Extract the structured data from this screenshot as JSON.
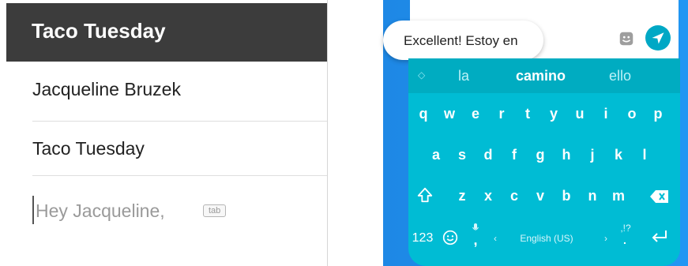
{
  "compose": {
    "header_title": "Taco Tuesday",
    "to": "Jacqueline Bruzek",
    "subject": "Taco Tuesday",
    "body_text": "Hey Jacqueline,",
    "tab_hint": "tab"
  },
  "chat": {
    "suggestion_text": "Excellent! Estoy en"
  },
  "keyboard": {
    "suggestions": [
      "la",
      "camino",
      "ello"
    ],
    "row1": [
      "q",
      "w",
      "e",
      "r",
      "t",
      "y",
      "u",
      "i",
      "o",
      "p"
    ],
    "row2": [
      "a",
      "s",
      "d",
      "f",
      "g",
      "h",
      "j",
      "k",
      "l"
    ],
    "row3": [
      "z",
      "x",
      "c",
      "v",
      "b",
      "n",
      "m"
    ],
    "numbers_label": "123",
    "space_label": "English (US)",
    "punct_hint": ",!?",
    "comma": ","
  },
  "colors": {
    "header_bg": "#3c3c3c",
    "keyboard_bg": "#00bcd4",
    "suggestion_bar_bg": "#00acc1",
    "phone_bg": "#2196f3",
    "send_button": "#00a8c5"
  },
  "icons": {
    "shift": "shift-icon",
    "backspace": "backspace-icon",
    "emoji": "emoji-icon",
    "mic": "mic-icon",
    "enter": "enter-icon",
    "send": "send-icon",
    "sticker": "sticker-icon",
    "expand": "expand-icon"
  }
}
